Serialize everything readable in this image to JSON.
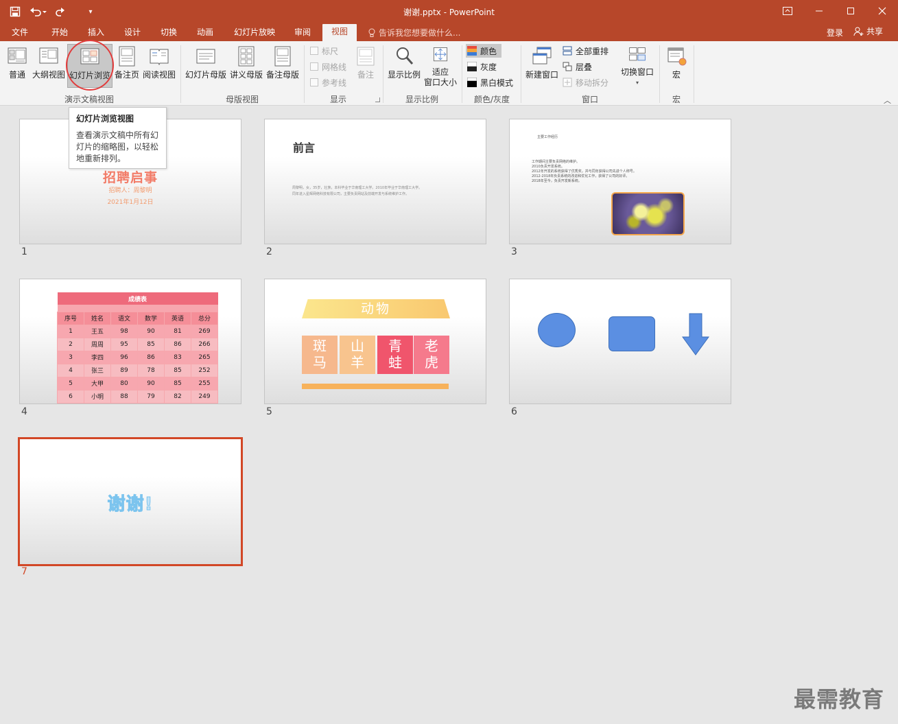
{
  "window": {
    "title": "谢谢.pptx - PowerPoint"
  },
  "tabs": [
    {
      "label": "文件"
    },
    {
      "label": "开始"
    },
    {
      "label": "插入"
    },
    {
      "label": "设计"
    },
    {
      "label": "切换"
    },
    {
      "label": "动画"
    },
    {
      "label": "幻灯片放映"
    },
    {
      "label": "审阅"
    },
    {
      "label": "视图"
    }
  ],
  "tell_me_placeholder": "告诉我您想要做什么...",
  "account": {
    "signin": "登录",
    "share": "共享"
  },
  "ribbon": {
    "presentation_views": {
      "label": "演示文稿视图",
      "buttons": [
        {
          "label": "普通"
        },
        {
          "label": "大纲视图"
        },
        {
          "label": "幻灯片浏览"
        },
        {
          "label": "备注页"
        },
        {
          "label": "阅读视图"
        }
      ]
    },
    "master_views": {
      "label": "母版视图",
      "buttons": [
        {
          "label": "幻灯片母版"
        },
        {
          "label": "讲义母版"
        },
        {
          "label": "备注母版"
        }
      ]
    },
    "show": {
      "label": "显示",
      "ruler": "标尺",
      "gridlines": "网格线",
      "guides": "参考线",
      "notes": "备注"
    },
    "zoom": {
      "label": "显示比例",
      "zoom": "显示比例",
      "fit_line1": "适应",
      "fit_line2": "窗口大小"
    },
    "color": {
      "label": "颜色/灰度",
      "color": "颜色",
      "grayscale": "灰度",
      "bw": "黑白模式"
    },
    "window": {
      "label": "窗口",
      "new_window": "新建窗口",
      "arrange_all": "全部重排",
      "cascade": "层叠",
      "move_split": "移动拆分",
      "switch_windows": "切换窗口"
    },
    "macros": {
      "label": "宏",
      "macros": "宏"
    }
  },
  "tooltip": {
    "title": "幻灯片浏览视图",
    "body": "查看演示文稿中所有幻灯片的缩略图，以轻松地重新排列。"
  },
  "slides": {
    "s1": {
      "num": "1",
      "title": "招聘启事",
      "subtitle": "招聘人：周黎明",
      "date": "2021年1月12日"
    },
    "s2": {
      "num": "2",
      "title": "前言",
      "line1": "周黎明，女，35岁，壮族，本科毕业于华南理工大学。2010年毕业于华南理工大学。",
      "line2": "同年进入星辉网络科技有限公司，主要负责网站及前端开发与系统维护工作。"
    },
    "s3": {
      "num": "3",
      "heading": "主要工作经历",
      "lines": [
        "工作期间主要负责网络的维护。",
        "2010负责开发系统。",
        "2012年开发的系统获得了优秀奖，并与同年获得公司先进个人称号。",
        "2012-2018年负责系统的改进和优化工作，获得了公司的好评。",
        "2018年至今，负责开发新系统。"
      ]
    },
    "s4": {
      "num": "4",
      "caption": "成绩表",
      "headers": [
        "序号",
        "姓名",
        "语文",
        "数学",
        "英语",
        "总分"
      ],
      "rows": [
        [
          "1",
          "王五",
          "98",
          "90",
          "81",
          "269"
        ],
        [
          "2",
          "周周",
          "95",
          "85",
          "86",
          "266"
        ],
        [
          "3",
          "李四",
          "96",
          "86",
          "83",
          "265"
        ],
        [
          "4",
          "张三",
          "89",
          "78",
          "85",
          "252"
        ],
        [
          "5",
          "大甲",
          "80",
          "90",
          "85",
          "255"
        ],
        [
          "6",
          "小明",
          "88",
          "79",
          "82",
          "249"
        ]
      ]
    },
    "s5": {
      "num": "5",
      "banner": "动物",
      "tiles": [
        {
          "top": "斑",
          "bottom": "马",
          "color": "#f6b88d"
        },
        {
          "top": "山",
          "bottom": "羊",
          "color": "#f8c48e"
        },
        {
          "top": "青",
          "bottom": "蛙",
          "color": "#f0556c"
        },
        {
          "top": "老",
          "bottom": "虎",
          "color": "#f57a8c"
        }
      ]
    },
    "s6": {
      "num": "6"
    },
    "s7": {
      "num": "7",
      "text": "谢谢!"
    }
  },
  "colors": {
    "accent": "#b7472a",
    "selection": "#d24726",
    "shape_blue": "#5b8fe2"
  },
  "watermark": "最需教育"
}
